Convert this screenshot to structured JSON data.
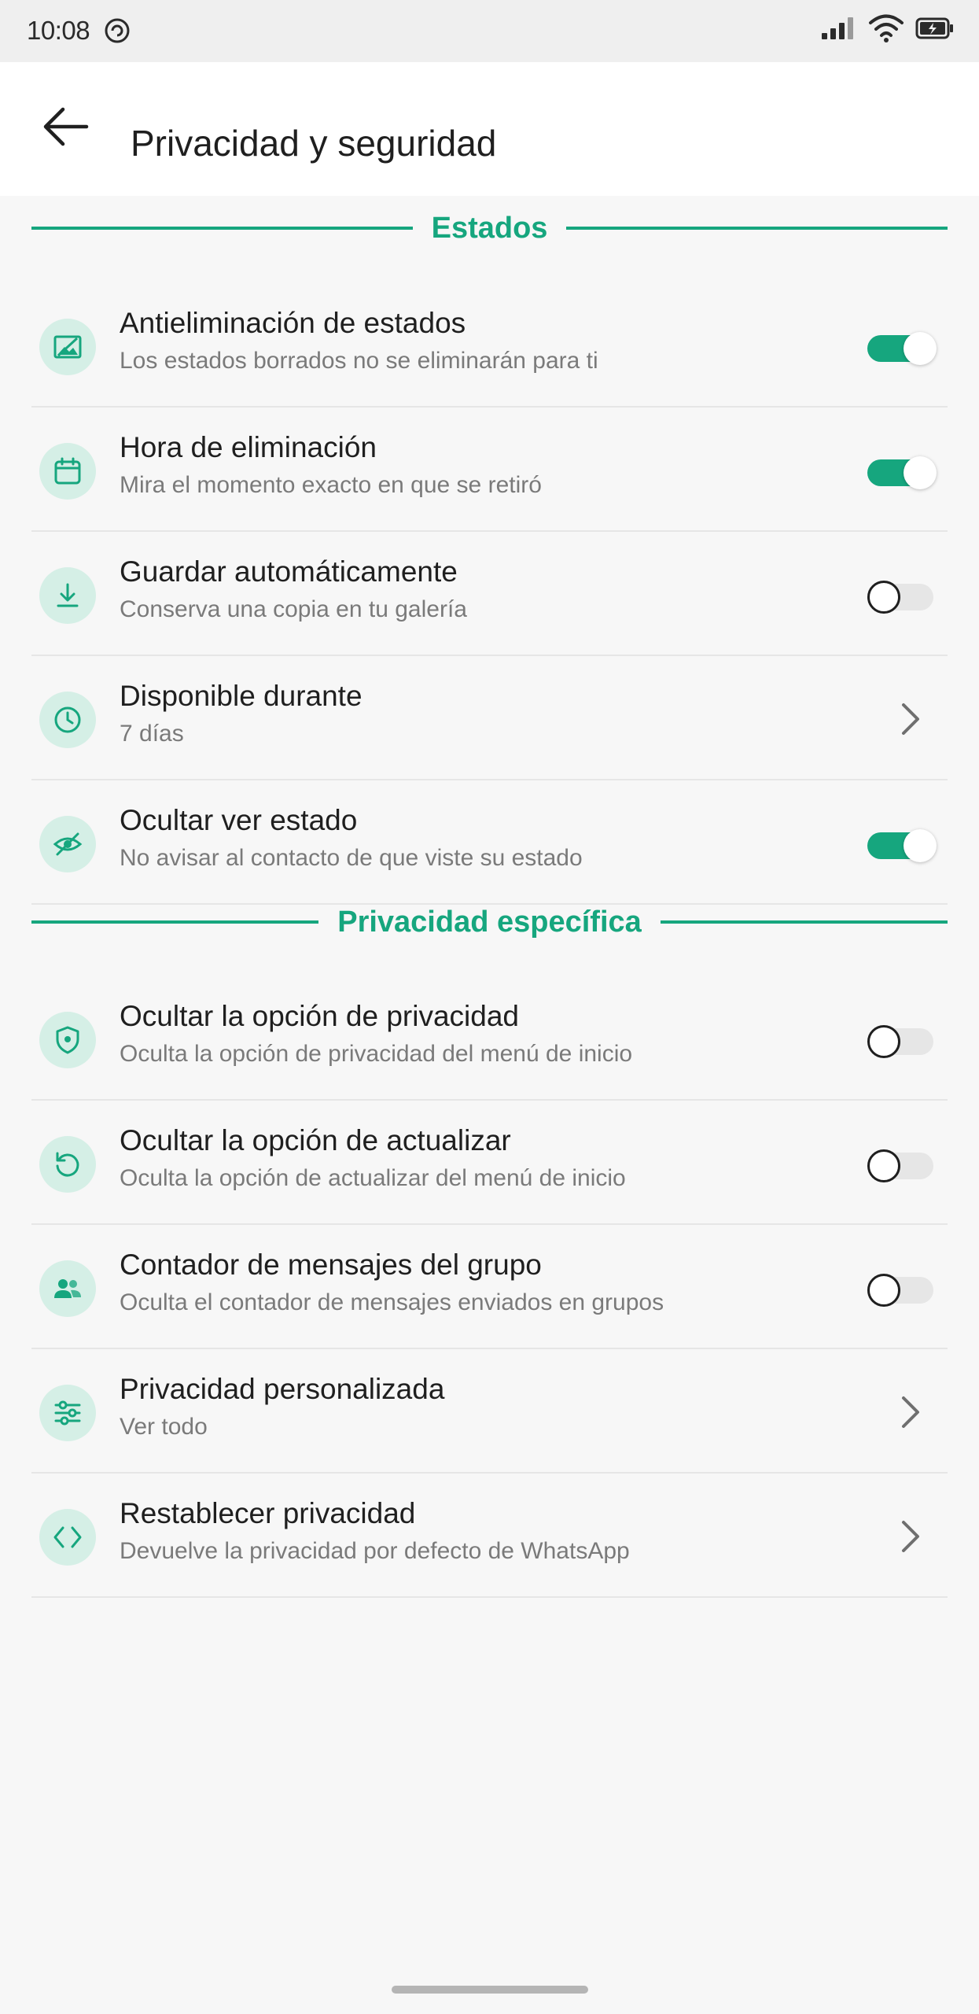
{
  "status_bar": {
    "time": "10:08",
    "icons": [
      "sync-icon",
      "signal-icon",
      "wifi-icon",
      "battery-icon"
    ]
  },
  "app_bar": {
    "title": "Privacidad y seguridad",
    "back_icon": "arrow-left-icon"
  },
  "colors": {
    "accent": "#16a67e",
    "icon_bg": "#d5efe6",
    "background": "#f7f7f7"
  },
  "sections": [
    {
      "title": "Estados",
      "items": [
        {
          "title": "Antieliminación de estados",
          "subtitle": "Los estados borrados no se eliminarán para ti",
          "icon": "image-icon",
          "control": "toggle",
          "checked": true
        },
        {
          "title": "Hora de eliminación",
          "subtitle": "Mira el momento exacto en que se retiró",
          "icon": "calendar-icon",
          "control": "toggle",
          "checked": true
        },
        {
          "title": "Guardar automáticamente",
          "subtitle": "Conserva una copia en tu galería",
          "icon": "download-icon",
          "control": "toggle",
          "checked": false
        },
        {
          "title": "Disponible durante",
          "subtitle": "7 días",
          "icon": "clock-icon",
          "control": "chevron"
        },
        {
          "title": "Ocultar ver estado",
          "subtitle": "No avisar al contacto de que viste su estado",
          "icon": "eye-off-icon",
          "control": "toggle",
          "checked": true
        }
      ]
    },
    {
      "title": "Privacidad específica",
      "items": [
        {
          "title": "Ocultar la opción de privacidad",
          "subtitle": "Oculta la opción de privacidad del menú de inicio",
          "icon": "shield-icon",
          "control": "toggle",
          "checked": false
        },
        {
          "title": "Ocultar la opción de actualizar",
          "subtitle": "Oculta la opción de actualizar del menú de inicio",
          "icon": "refresh-icon",
          "control": "toggle",
          "checked": false
        },
        {
          "title": "Contador de mensajes del grupo",
          "subtitle": "Oculta el contador de mensajes enviados en grupos",
          "icon": "group-icon",
          "control": "toggle",
          "checked": false
        },
        {
          "title": "Privacidad personalizada",
          "subtitle": "Ver todo",
          "icon": "sliders-icon",
          "control": "chevron"
        },
        {
          "title": "Restablecer privacidad",
          "subtitle": "Devuelve la privacidad por defecto de WhatsApp",
          "icon": "code-icon",
          "control": "chevron"
        }
      ]
    }
  ]
}
